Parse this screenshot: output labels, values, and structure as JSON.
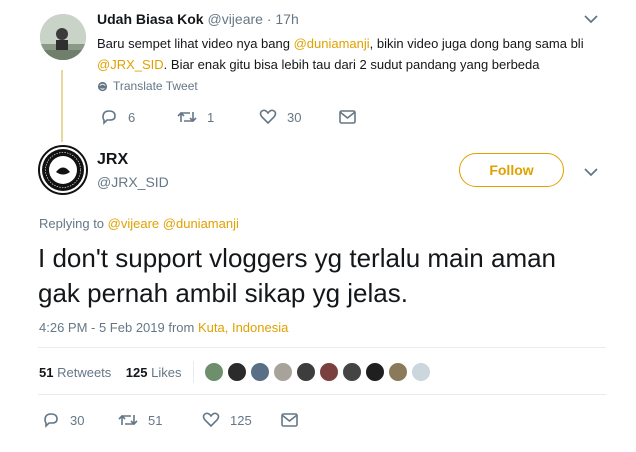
{
  "reply_tweet": {
    "display_name": "Udah Biasa Kok",
    "handle": "@vijeare",
    "separator": "·",
    "time": "17h",
    "text_segments": [
      {
        "t": "Baru sempet lihat video nya bang ",
        "link": false
      },
      {
        "t": "@duniamanji",
        "link": true
      },
      {
        "t": ", bikin video juga dong bang sama bli ",
        "link": false
      },
      {
        "t": "@JRX_SID",
        "link": true
      },
      {
        "t": ". Biar enak gitu bisa lebih tau dari 2 sudut pandang yang berbeda",
        "link": false
      }
    ],
    "translate_label": "Translate Tweet",
    "actions": {
      "replies": "6",
      "retweets": "1",
      "likes": "30"
    }
  },
  "main_tweet": {
    "display_name": "JRX",
    "handle": "@JRX_SID",
    "avatar_text_top": "TOLAK REKLAMASI",
    "avatar_text_bottom": "TELUK BENOA",
    "follow_label": "Follow",
    "replying_to_label": "Replying to",
    "replying_to_1": "@vijeare",
    "replying_to_2": "@duniamanji",
    "text_line1": "I don't support vloggers yg terlalu main aman",
    "text_line2": "gak pernah ambil sikap yg jelas.",
    "timestamp": "4:26 PM - 5 Feb 2019 from",
    "location": "Kuta, Indonesia",
    "retweets_count": "51",
    "retweets_label": "Retweets",
    "likes_count": "125",
    "likes_label": "Likes",
    "actions": {
      "replies": "30",
      "retweets": "51",
      "likes": "125"
    }
  },
  "colors": {
    "accent": "#e0a100",
    "muted": "#657786",
    "divider": "#e6ecf0"
  }
}
